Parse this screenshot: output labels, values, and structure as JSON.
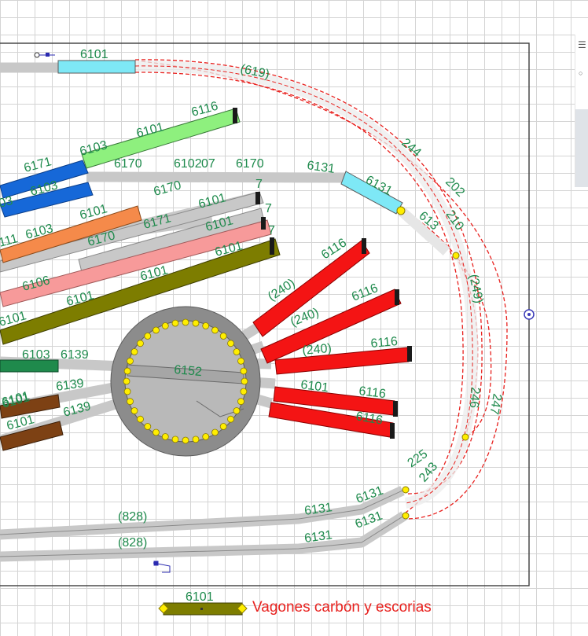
{
  "track_labels": {
    "top_main": "6101",
    "outer_loop": "(619)",
    "curve_244": "244",
    "curve_202": "202",
    "curve_210": "210",
    "curve_249": "(249)",
    "curve_246": "246",
    "curve_247": "247",
    "curve_225": "225",
    "curve_243": "243",
    "green_6116": "6116",
    "green_6101": "6101",
    "green_6103": "6103",
    "blue_6171": "6171",
    "blue_6103": "6103",
    "blue_03": "03",
    "grey_6170_a": "6170",
    "grey_6102": "6102",
    "grey_07": "07",
    "grey_6170_b": "6170",
    "grey_6131_top": "6131",
    "cyan_6131": "6131",
    "grey_613": "613",
    "grey_6170_c": "6170",
    "grey_6101_row2": "6101",
    "grey_x7_a": "7",
    "orange_6101": "6101",
    "orange_6103": "6103",
    "orange_111": "111",
    "grey_6171_mid": "6171",
    "grey_6170_mid": "6170",
    "pink_6101": "6101",
    "pink_x7": "7",
    "olive_6101": "6101",
    "pink_6106": "6106",
    "olive_6101_b": "6101",
    "olive_6101_c": "6101",
    "olive_6101_left": "6101",
    "blue_6101_clip": "6101",
    "grey_x7_b": "7",
    "red_6116_1": "6116",
    "red_240_1": "(240)",
    "red_240_2": "(240)",
    "red_6116_2": "6116",
    "red_240_3": "(240)",
    "red_6116_3": "6116",
    "red_6101": "6101",
    "red_6116_4": "6116",
    "red_6116_5": "6116",
    "turntable": "6152",
    "green_left_6103": "6103",
    "grey_6139_a": "6139",
    "grey_6139_b": "6139",
    "grey_6139_c": "6139",
    "brown_6101_a": "6101",
    "brown_6101_b": "6101",
    "bottom_828_a": "(828)",
    "bottom_828_b": "(828)",
    "bottom_6131_a": "6131",
    "bottom_6131_b": "6131",
    "bottom_6131_c": "6131",
    "bottom_6131_d": "6131"
  },
  "legend": {
    "wagon_code": "6101",
    "caption": "Vagones carbón y escorias",
    "wagon_color": "#7d7d00",
    "caption_color": "#e8211e"
  },
  "colors": {
    "label": "#1e8a4c",
    "grey_track": "#c8c8c8",
    "cyan": "#7ee8f6",
    "green": "#8ef07e",
    "blue": "#1668d8",
    "orange": "#f58a4a",
    "pink": "#f79a9a",
    "olive": "#7d7d00",
    "red": "#f41414",
    "dark_green": "#1f8a4c",
    "brown": "#7d4114",
    "dashed": "#e8211e",
    "turntable": "#b9b9b9",
    "pit_ring": "#8c8c8c",
    "light": "#ffee00",
    "marker": "#3a3ab8"
  },
  "side_panel": {
    "glyph": "☰",
    "dot": "○"
  }
}
